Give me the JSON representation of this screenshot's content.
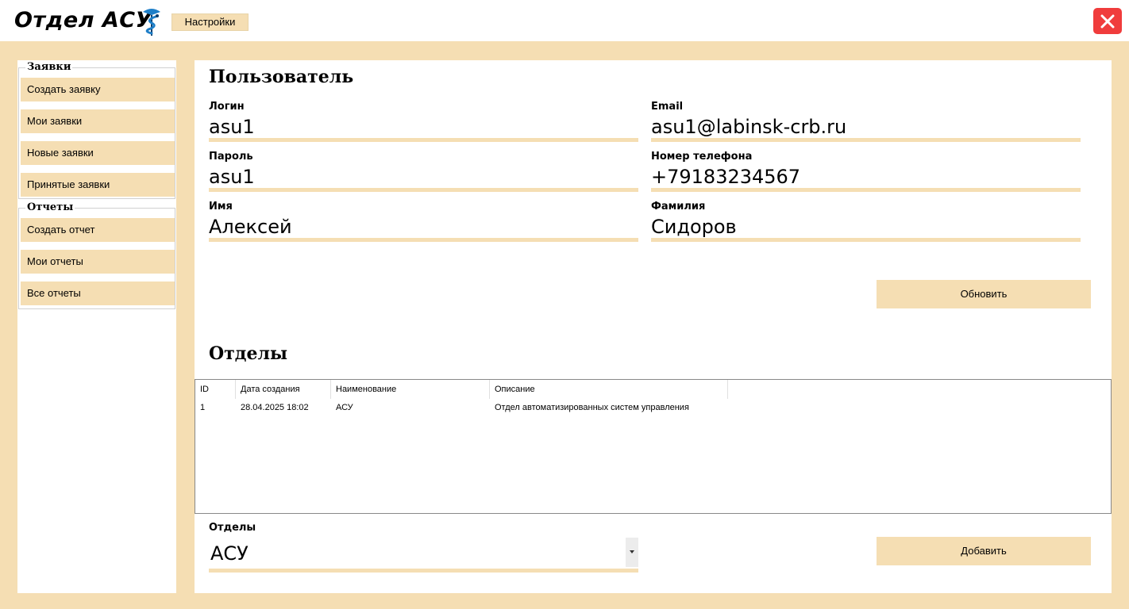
{
  "header": {
    "title": "Отдел АСУ",
    "logo_icon": "medical-caduceus-icon",
    "settings_label": "Настройки",
    "close_icon": "close-icon",
    "close_color": "#f03c3c"
  },
  "sidebar": {
    "groups": [
      {
        "title": "Заявки",
        "items": [
          {
            "label": "Создать заявку"
          },
          {
            "label": "Мои заявки"
          },
          {
            "label": "Новые заявки"
          },
          {
            "label": "Принятые заявки"
          }
        ]
      },
      {
        "title": "Отчеты",
        "items": [
          {
            "label": "Создать отчет"
          },
          {
            "label": "Мои отчеты"
          },
          {
            "label": "Все отчеты"
          }
        ]
      }
    ]
  },
  "user": {
    "title": "Пользователь",
    "login_label": "Логин",
    "login_value": "asu1",
    "email_label": "Email",
    "email_value": "asu1@labinsk-crb.ru",
    "password_label": "Пароль",
    "password_value": "asu1",
    "phone_label": "Номер телефона",
    "phone_value": "+79183234567",
    "name_label": "Имя",
    "name_value": "Алексей",
    "surname_label": "Фамилия",
    "surname_value": "Сидоров",
    "update_label": "Обновить"
  },
  "departments": {
    "title": "Отделы",
    "columns": [
      "ID",
      "Дата создания",
      "Наименование",
      "Описание"
    ],
    "rows": [
      [
        "1",
        "28.04.2025 18:02",
        "АСУ",
        "Отдел автоматизированных систем управления"
      ]
    ],
    "select_label": "Отделы",
    "select_value": "АСУ",
    "add_label": "Добавить"
  },
  "colors": {
    "accent": "#f5deb3",
    "background": "#ffffff"
  }
}
